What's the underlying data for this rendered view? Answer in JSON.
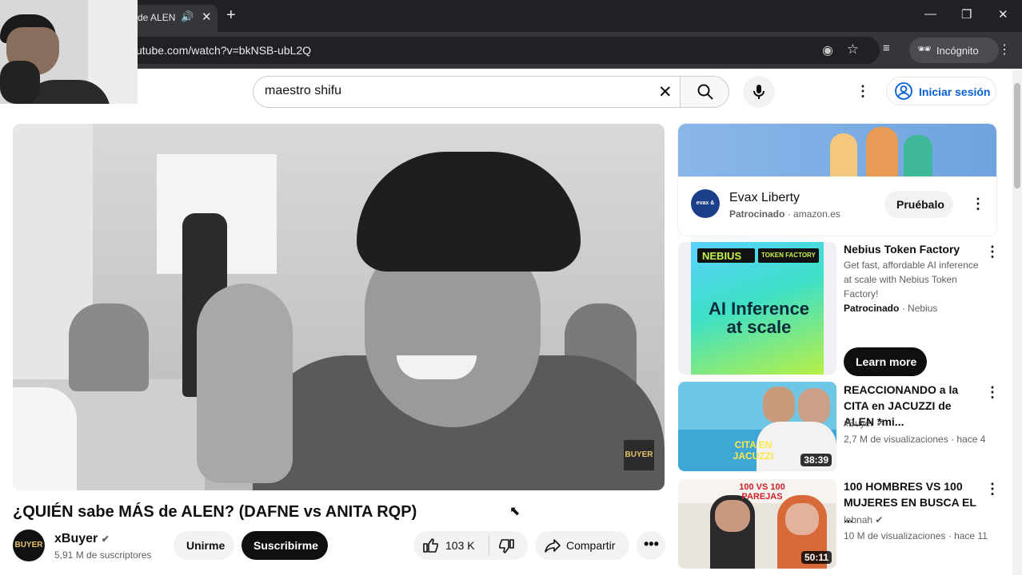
{
  "browser": {
    "tab_title": "de ALEN",
    "tab_close": "✕",
    "new_tab": "+",
    "url": "utube.com/watch?v=bkNSB-ubL2Q",
    "incognito_label": "Incógnito",
    "window_controls": [
      "—",
      "❐",
      "✕"
    ]
  },
  "yt_header": {
    "search_value": "maestro shifu",
    "signin_label": "Iniciar sesión"
  },
  "video": {
    "title": "¿QUIÉN sabe MÁS de ALEN? (DAFNE vs ANITA RQP)",
    "watermark": "BUYER",
    "channel_name": "xBuyer",
    "subscribers": "5,91 M de suscriptores",
    "avatar_text": "BUYER",
    "join_label": "Unirme",
    "subscribe_label": "Suscribirme",
    "likes": "103 K",
    "share_label": "Compartir"
  },
  "sidebar": {
    "ad_display": {
      "name": "Evax Liberty",
      "sponsored": "Patrocinado",
      "domain": "amazon.es",
      "cta": "Pruébalo",
      "logo_text": "evax & TAMPAX"
    },
    "ad_video": {
      "title": "Nebius Token Factory",
      "description": "Get fast, affordable AI inference at scale with Nebius Token Factory!",
      "sponsored": "Patrocinado",
      "advertiser": "Nebius",
      "cta": "Learn more",
      "thumb_brand": "NEBIUS",
      "thumb_tag": "TOKEN FACTORY",
      "thumb_headline": "AI Inference at scale"
    },
    "items": [
      {
        "title": "REACCIONANDO a la CITA en JACUZZI de ALEN *mi...",
        "channel": "xBuyer",
        "meta": "2,7 M de visualizaciones · hace 4 ...",
        "duration": "38:39",
        "thumb_text": "CITA EN JACUZZI"
      },
      {
        "title": "100 HOMBRES VS 100 MUJERES EN BUSCA EL ...",
        "channel": "lebnah",
        "meta": "10 M de visualizaciones · hace 11...",
        "duration": "50:11",
        "thumb_text": "100 VS 100 PAREJAS"
      }
    ]
  },
  "colors": {
    "chrome_dark": "#202124",
    "chrome_toolbar": "#35363a",
    "yt_blue": "#065fd4",
    "nebius_green": "#c7f24a"
  }
}
